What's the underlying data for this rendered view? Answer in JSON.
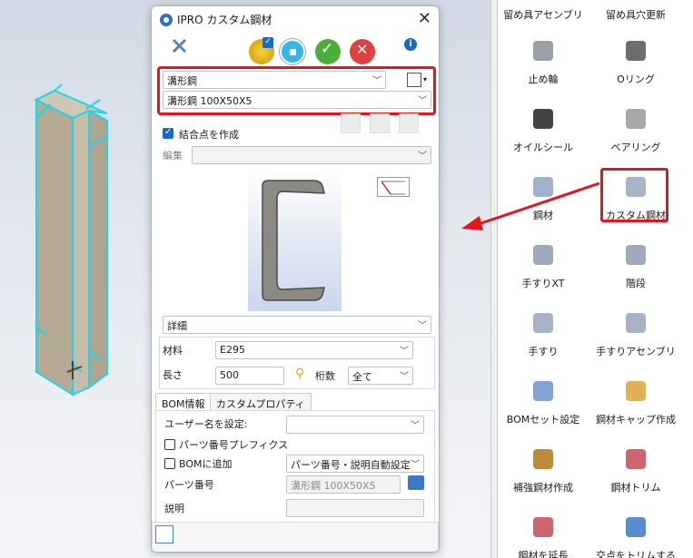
{
  "dialog": {
    "title": "IPRO カスタム鋼材",
    "type_value": "溝形鋼",
    "size_value": "溝形鋼 100X50X5",
    "create_node_label": "結合点を作成",
    "edit_label": "編集",
    "edit_value": "",
    "detail_value": "詳細",
    "material_label": "材料",
    "material_value": "E295",
    "length_label": "長さ",
    "length_value": "500",
    "digits_label": "桁数",
    "digits_value": "全て",
    "tabs": [
      "BOM情報",
      "カスタムプロパティ"
    ],
    "username_label": "ユーザー名を設定:",
    "username_value": "",
    "part_prefix_label": "パーツ番号プレフィクス",
    "add_bom_label": "BOMに追加",
    "auto_setting_value": "パーツ番号・説明自動設定",
    "part_number_label": "パーツ番号",
    "part_number_value": "溝形鋼 100X50X5",
    "description_label": "説明",
    "description_value": ""
  },
  "palette": {
    "items": [
      {
        "label": "留め具アセンブリ"
      },
      {
        "label": "留め具穴更新"
      },
      {
        "label": "止め輪"
      },
      {
        "label": "Oリング"
      },
      {
        "label": "オイルシール"
      },
      {
        "label": "ベアリング"
      },
      {
        "label": "鋼材"
      },
      {
        "label": "カスタム鋼材"
      },
      {
        "label": "手すりXT"
      },
      {
        "label": "階段"
      },
      {
        "label": "手すり"
      },
      {
        "label": "手すりアセンブリ"
      },
      {
        "label": "BOMセット設定"
      },
      {
        "label": "鋼材キャップ作成"
      },
      {
        "label": "補強鋼材作成"
      },
      {
        "label": "鋼材トリム"
      },
      {
        "label": "鋼材を延長"
      },
      {
        "label": "交点をトリムする"
      }
    ]
  },
  "colors": {
    "highlight": "#e3161d",
    "selection_cyan": "#22d3ee",
    "steel_tan": "#bfb39e",
    "accent_blue": "#1769c7"
  }
}
